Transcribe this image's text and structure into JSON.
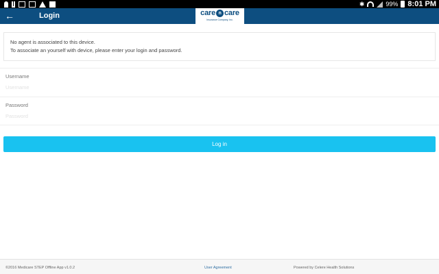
{
  "status_bar": {
    "left_icons": [
      "person-icon",
      "usb-icon",
      "image-icon",
      "mail-icon",
      "warning-icon",
      "screenshot-icon"
    ],
    "right_icons": [
      "bluetooth-icon",
      "wifi-icon",
      "signal-icon",
      "battery-icon"
    ],
    "battery_percent": "99%",
    "time": "8:01 PM"
  },
  "app_bar": {
    "back_icon": "arrow-left-icon",
    "title": "Login",
    "color": "#0d4e80"
  },
  "logo": {
    "word_left": "care",
    "word_mid": "n",
    "word_right": "care",
    "subtitle": "Insurance Company, Inc."
  },
  "notice": {
    "line1": "No agent is associated to this device.",
    "line2": "To associate an yourself with device, please enter your login and password."
  },
  "form": {
    "username_label": "Username",
    "username_placeholder": "Username",
    "username_value": "",
    "password_label": "Password",
    "password_placeholder": "Password",
    "password_value": "",
    "login_button": "Log in",
    "button_color": "#19c2f0"
  },
  "footer": {
    "copyright": "©2016 Medicare STEP Offline App v1.0.2",
    "agreement_link": "User Agreement",
    "powered_by": "Powered by Celere Health Solutions"
  }
}
